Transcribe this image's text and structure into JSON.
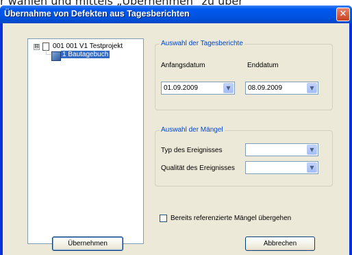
{
  "background_text": "r wählen und mittels „Übernehmen\" zu über",
  "dialog": {
    "title": "Übernahme von Defekten aus Tagesberichten",
    "close_glyph": "✕"
  },
  "tree": {
    "root_expander": "⊟",
    "root_label": "001 001 V1 Testprojekt",
    "child_label": "1 Bautagebuch"
  },
  "reports_group": {
    "legend": "Auswahl der Tagesberichte",
    "start_label": "Anfangsdatum",
    "end_label": "Enddatum",
    "start_value": "01.09.2009",
    "end_value": "08.09.2009"
  },
  "defects_group": {
    "legend": "Auswahl der Mängel",
    "type_label": "Typ des Ereignisses",
    "quality_label": "Qualität des Ereignisses",
    "type_value": "",
    "quality_value": ""
  },
  "checkbox": {
    "label": "Bereits referenzierte Mängel übergehen",
    "checked": false
  },
  "buttons": {
    "apply": "Übernehmen",
    "cancel": "Abbrechen"
  },
  "dropdown_glyph": "▼",
  "colors": {
    "title_bar": "#0054e3",
    "dialog_bg": "#ece9d8",
    "group_label": "#0046d5",
    "selection": "#316ac5"
  }
}
